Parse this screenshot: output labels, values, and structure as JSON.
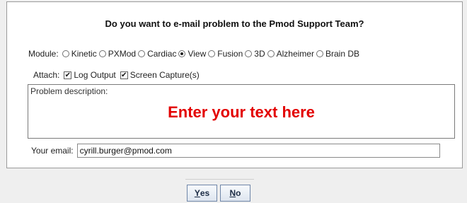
{
  "dialog": {
    "title": "Do you want to e-mail problem to the Pmod Support Team?"
  },
  "module": {
    "label": "Module:",
    "options": [
      "Kinetic",
      "PXMod",
      "Cardiac",
      "View",
      "Fusion",
      "3D",
      "Alzheimer",
      "Brain DB"
    ],
    "selected": "View"
  },
  "attach": {
    "label": "Attach:",
    "options": [
      {
        "label": "Log Output",
        "checked": true
      },
      {
        "label": "Screen Capture(s)",
        "checked": true
      }
    ]
  },
  "description": {
    "label": "Problem description:",
    "prompt": "Enter your text here"
  },
  "email": {
    "label": "Your email:",
    "value": "cyrill.burger@pmod.com"
  },
  "buttons": {
    "yes_mnemonic": "Y",
    "yes_rest": "es",
    "no_mnemonic": "N",
    "no_rest": "o"
  },
  "colors": {
    "prompt": "#e30000",
    "button_border": "#6f86a8"
  }
}
